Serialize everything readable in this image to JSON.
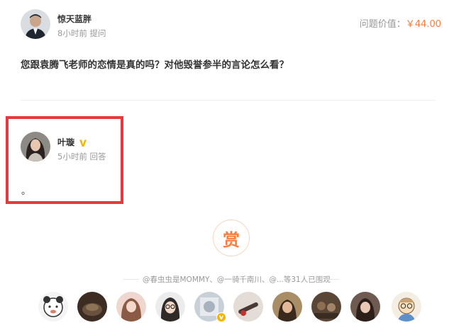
{
  "question": {
    "asker_name": "惊天蓝胖",
    "asker_meta": "8小时前 提问",
    "price_label": "问题价值：",
    "price_value": "￥44.00",
    "text": "您跟袁腾飞老师的恋情是真的吗？对他毁誉参半的言论怎么看？"
  },
  "answer": {
    "answerer_name": "叶璇",
    "answerer_meta": "5小时前 回答",
    "text": "。",
    "verified_icon": "vip-v-icon"
  },
  "reward": {
    "label": "赏"
  },
  "onlookers": {
    "text": "@春虫虫是MOMMY、@一骑千南川、@...等31人已围观",
    "avatars": [
      "onlooker-1",
      "onlooker-2",
      "onlooker-3",
      "onlooker-4",
      "onlooker-5",
      "onlooker-6",
      "onlooker-7",
      "onlooker-8",
      "onlooker-9",
      "onlooker-10",
      "onlooker-11"
    ]
  },
  "colors": {
    "accent_orange": "#fa7d3c",
    "highlight_red": "#e5393b",
    "muted_text": "#999999",
    "primary_text": "#333333"
  }
}
